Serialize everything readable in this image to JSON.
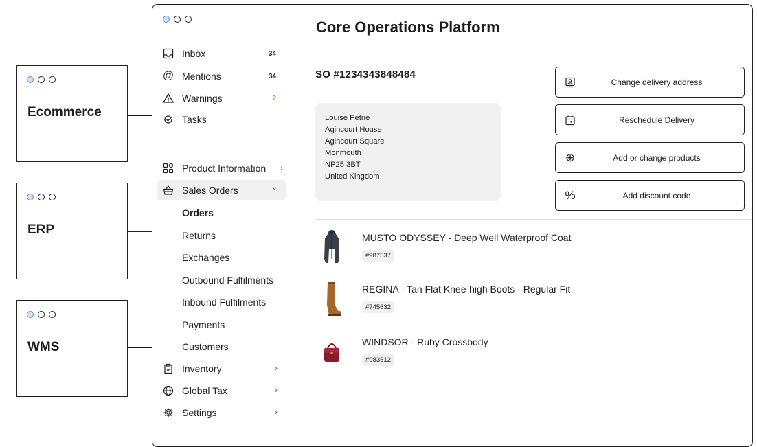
{
  "systems": [
    {
      "name": "Ecommerce"
    },
    {
      "name": "ERP"
    },
    {
      "name": "WMS"
    }
  ],
  "app": {
    "title": "Core Operations Platform"
  },
  "sidebar": {
    "inbox": {
      "label": "Inbox",
      "icon": "inbox-icon",
      "count": "34"
    },
    "mentions": {
      "label": "Mentions",
      "icon": "at-icon",
      "count": "34"
    },
    "warnings": {
      "label": "Warnings",
      "icon": "warning-icon",
      "count": "2"
    },
    "tasks": {
      "label": "Tasks",
      "icon": "tasks-icon"
    },
    "product_information": {
      "label": "Product Information",
      "icon": "grid-icon",
      "chevron": "›"
    },
    "sales_orders": {
      "label": "Sales Orders",
      "icon": "basket-icon",
      "chevron": "⌄",
      "children": [
        "Orders",
        "Returns",
        "Exchanges",
        "Outbound Fulfilments",
        "Inbound Fulfilments",
        "Payments",
        "Customers"
      ]
    },
    "inventory": {
      "label": "Inventory",
      "icon": "clipboard-icon",
      "chevron": "›"
    },
    "global_tax": {
      "label": "Global Tax",
      "icon": "globe-icon",
      "chevron": "›"
    },
    "settings": {
      "label": "Settings",
      "icon": "gear-icon",
      "chevron": "›"
    }
  },
  "order": {
    "id": "SO #1234343848484",
    "address": [
      "Louise Petrie",
      "Agincourt House",
      "Agincourt Square",
      "Monmouth",
      "NP25 3BT",
      "United Kingdom"
    ]
  },
  "actions": [
    {
      "label": "Change delivery address",
      "icon": "address-icon"
    },
    {
      "label": "Reschedule Delivery",
      "icon": "calendar-icon"
    },
    {
      "label": "Add or change products",
      "icon": "plus-circle-icon",
      "glyph": "⊕"
    },
    {
      "label": "Add discount code",
      "icon": "percent-icon",
      "glyph": "%"
    }
  ],
  "products": [
    {
      "name": "MUSTO ODYSSEY - Deep Well Waterproof Coat",
      "sku": "#987537",
      "color": "#3a3f47"
    },
    {
      "name": "REGINA - Tan Flat Knee-high Boots - Regular Fit",
      "sku": "#745632",
      "color": "#a5682a"
    },
    {
      "name": "WINDSOR - Ruby Crossbody",
      "sku": "#983512",
      "color": "#8a1c28"
    }
  ],
  "colors": {
    "accent_dot": "#5b8ee6",
    "warning_count": "#e08a1e",
    "card_bg": "#f1f1f2"
  }
}
